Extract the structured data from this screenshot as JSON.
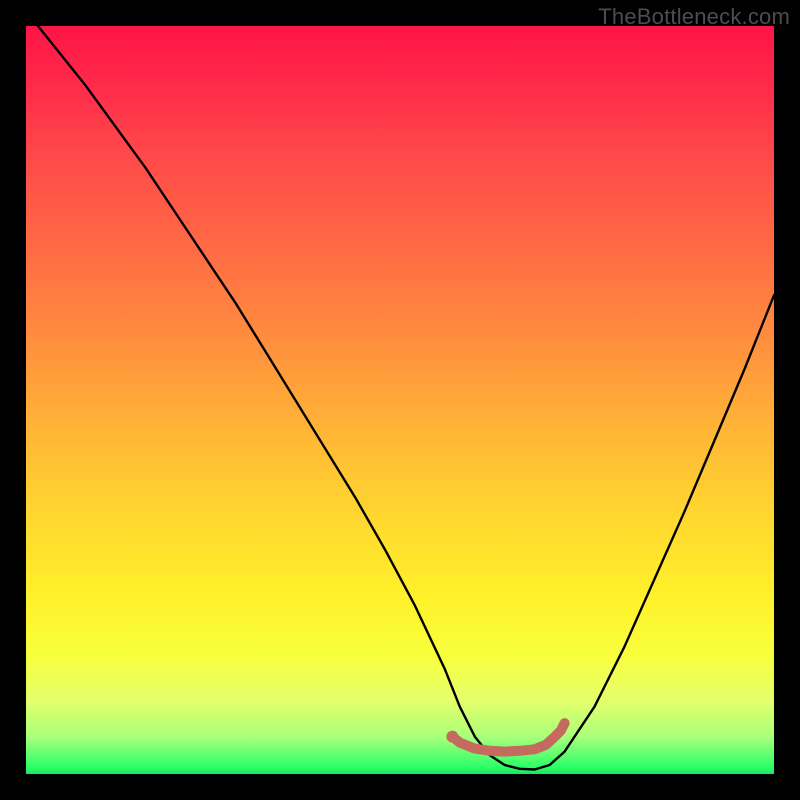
{
  "watermark": "TheBottleneck.com",
  "chart_data": {
    "type": "line",
    "title": "",
    "xlabel": "",
    "ylabel": "",
    "xlim": [
      0,
      100
    ],
    "ylim": [
      0,
      100
    ],
    "grid": false,
    "legend": false,
    "series": [
      {
        "name": "curve",
        "stroke": "#000000",
        "x": [
          0,
          4,
          8,
          12,
          16,
          20,
          24,
          28,
          32,
          36,
          40,
          44,
          48,
          52,
          56,
          58,
          60,
          62,
          64,
          66,
          68,
          70,
          72,
          76,
          80,
          84,
          88,
          92,
          96,
          100
        ],
        "y": [
          102,
          97,
          92,
          86.5,
          81,
          75,
          69,
          63,
          56.5,
          50,
          43.5,
          37,
          30,
          22.5,
          14,
          9,
          5,
          2.5,
          1.2,
          0.7,
          0.6,
          1.2,
          3,
          9,
          17,
          26,
          35,
          44.5,
          54,
          64
        ]
      },
      {
        "name": "highlight",
        "stroke": "#c46a5e",
        "x": [
          57,
          58,
          60,
          62,
          64,
          66,
          68,
          69.5,
          70.5,
          71.5,
          72
        ],
        "y": [
          5.0,
          4.2,
          3.4,
          3.1,
          3.0,
          3.1,
          3.3,
          3.9,
          4.8,
          5.8,
          6.8
        ]
      }
    ],
    "annotations": []
  }
}
